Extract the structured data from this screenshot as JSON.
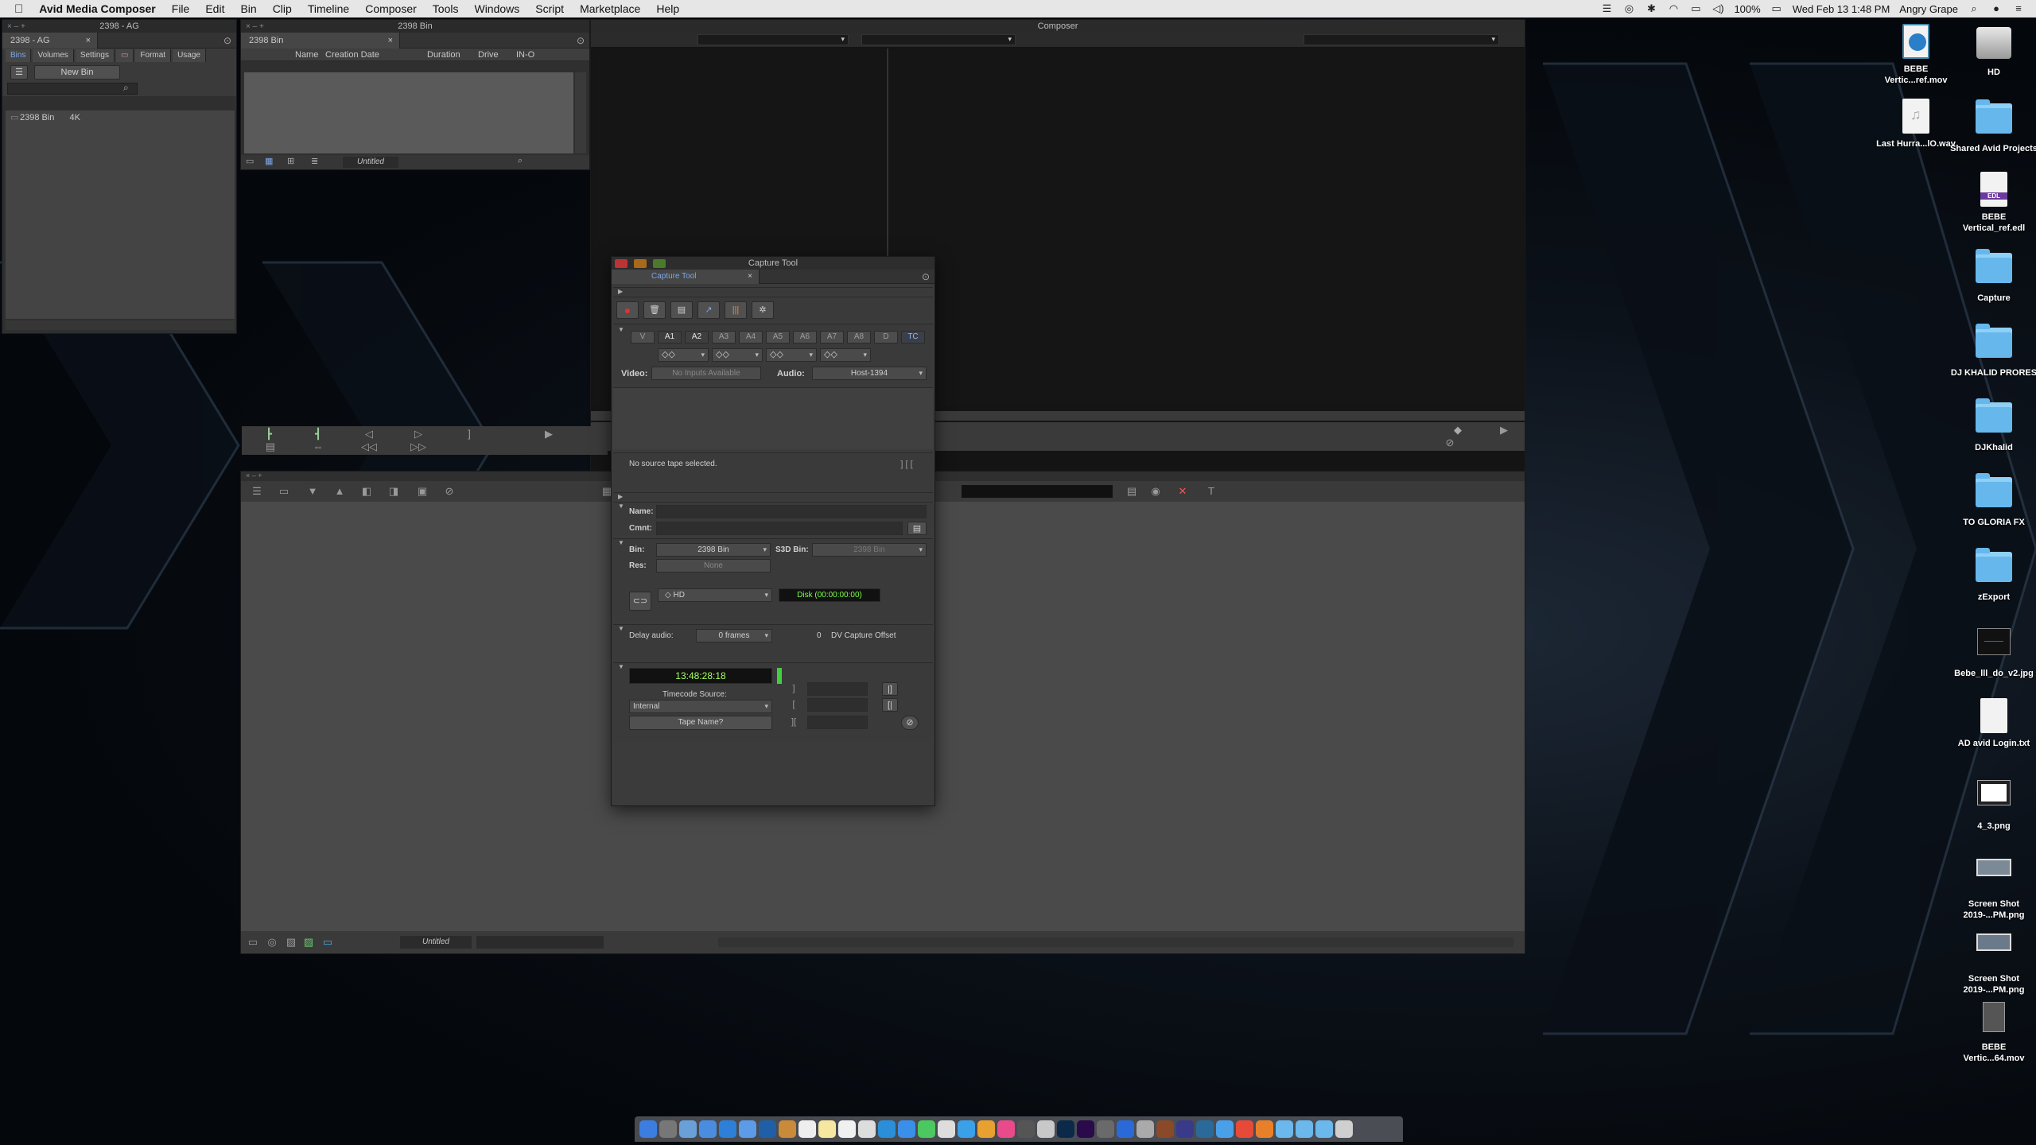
{
  "menubar": {
    "app_name": "Avid Media Composer",
    "menus": [
      "File",
      "Edit",
      "Bin",
      "Clip",
      "Timeline",
      "Composer",
      "Tools",
      "Windows",
      "Script",
      "Marketplace",
      "Help"
    ],
    "battery": "100%",
    "datetime": "Wed Feb 13  1:48 PM",
    "user": "Angry Grape"
  },
  "project_window": {
    "title": "2398 - AG",
    "tab_label": "2398 - AG",
    "tabs": [
      "Bins",
      "Volumes",
      "Settings",
      "",
      "Format",
      "Usage"
    ],
    "new_bin_label": "New Bin",
    "bin_name": "2398 Bin",
    "bin_format": "4K"
  },
  "bin_window": {
    "title": "2398 Bin",
    "tab_label": "2398 Bin",
    "columns": [
      "Name",
      "Creation Date",
      "Duration",
      "Drive",
      "IN-OUT"
    ],
    "view_name": "Untitled"
  },
  "composer": {
    "title": "Composer"
  },
  "timeline": {
    "view_name": "Untitled"
  },
  "capture_tool": {
    "title": "Capture Tool",
    "tab_label": "Capture Tool",
    "tracks": [
      "V",
      "A1",
      "A2",
      "A3",
      "A4",
      "A5",
      "A6",
      "A7",
      "A8",
      "D",
      "TC"
    ],
    "active_tracks": [
      "A1",
      "A2"
    ],
    "video_label": "Video:",
    "video_value": "No Inputs Available",
    "audio_label": "Audio:",
    "audio_value": "Host-1394",
    "source_status": "No source tape selected.",
    "name_label": "Name:",
    "comment_label": "Cmnt:",
    "bin_label": "Bin:",
    "bin_value": "2398 Bin",
    "s3d_bin_label": "S3D Bin:",
    "s3d_bin_value": "2398 Bin",
    "res_label": "Res:",
    "res_value": "None",
    "drive_value": "HD",
    "disk_status": "Disk (00:00:00:00)",
    "delay_audio_label": "Delay audio:",
    "delay_audio_value": "0 frames",
    "dv_offset_value": "0",
    "dv_offset_label": "DV Capture Offset",
    "timecode": "13:48:28:18",
    "timecode_source_label": "Timecode Source:",
    "timecode_source_value": "Internal",
    "tape_name_button": "Tape Name?",
    "colors": {
      "timecode_green": "#a6ff5c",
      "disk_text": "#7dff49"
    }
  },
  "desktop": {
    "icons": [
      {
        "label": "BEBE Vertic...ref.mov",
        "icon": "movie-file-icon"
      },
      {
        "label": "HD",
        "icon": "hard-drive-icon"
      },
      {
        "label": "Last Hurra...lO.wav",
        "icon": "audio-file-icon"
      },
      {
        "label": "Shared Avid Projects",
        "icon": "folder-icon"
      },
      {
        "label": "BEBE Vertical_ref.edl",
        "icon": "edl-file-icon"
      },
      {
        "label": "Capture",
        "icon": "folder-icon"
      },
      {
        "label": "DJ KHALID PRORES",
        "icon": "folder-icon"
      },
      {
        "label": "DJKhalid",
        "icon": "folder-icon"
      },
      {
        "label": "TO GLORIA FX",
        "icon": "folder-icon"
      },
      {
        "label": "zExport",
        "icon": "folder-icon"
      },
      {
        "label": "Bebe_lll_do_v2.jpg",
        "icon": "image-file-icon"
      },
      {
        "label": "AD avid Login.txt",
        "icon": "text-file-icon"
      },
      {
        "label": "4_3.png",
        "icon": "image-file-icon"
      },
      {
        "label": "Screen Shot 2019-...PM.png",
        "icon": "image-file-icon"
      },
      {
        "label": "Screen Shot 2019-...PM.png",
        "icon": "image-file-icon"
      },
      {
        "label": "BEBE Vertic...64.mov",
        "icon": "movie-file-icon"
      }
    ]
  }
}
